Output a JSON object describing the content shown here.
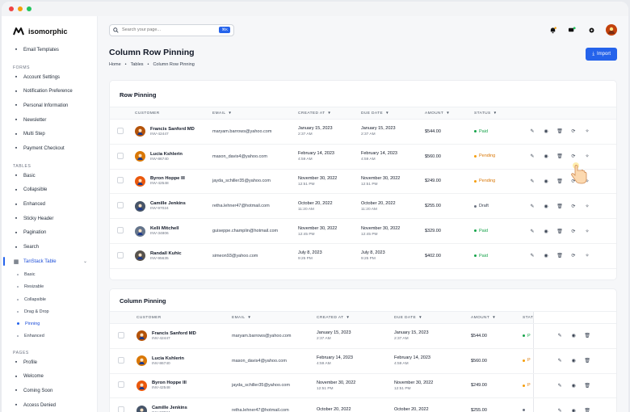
{
  "colors": {
    "accent": "#2563eb",
    "paid": "#16a34a",
    "pending": "#f59e0b",
    "draft": "#6b7280"
  },
  "brand": {
    "name": "isomorphic"
  },
  "sidebar": {
    "top_items": [
      {
        "label": "Email Templates",
        "icon": "mail-icon"
      }
    ],
    "forms_title": "FORMS",
    "forms_items": [
      {
        "label": "Account Settings",
        "icon": "user-settings-icon"
      },
      {
        "label": "Notification Preference",
        "icon": "bell-icon"
      },
      {
        "label": "Personal Information",
        "icon": "id-card-icon"
      },
      {
        "label": "Newsletter",
        "icon": "newsletter-icon"
      },
      {
        "label": "Multi Step",
        "icon": "steps-icon"
      },
      {
        "label": "Payment Checkout",
        "icon": "card-icon"
      }
    ],
    "tables_title": "TABLES",
    "tables_items": [
      {
        "label": "Basic",
        "icon": "grid-icon"
      },
      {
        "label": "Collapsible",
        "icon": "collapse-icon"
      },
      {
        "label": "Enhanced",
        "icon": "table-icon"
      },
      {
        "label": "Sticky Header",
        "icon": "sticky-icon"
      },
      {
        "label": "Pagination",
        "icon": "pagination-icon"
      },
      {
        "label": "Search",
        "icon": "search-table-icon"
      }
    ],
    "tanstack": {
      "label": "TanStack Table",
      "icon": "tanstack-icon"
    },
    "tanstack_subitems": [
      {
        "label": "Basic"
      },
      {
        "label": "Resizable"
      },
      {
        "label": "Collapsible"
      },
      {
        "label": "Drag & Drop"
      },
      {
        "label": "Pinning"
      },
      {
        "label": "Enhanced"
      }
    ],
    "pages_title": "PAGES",
    "pages_items": [
      {
        "label": "Profile",
        "icon": "profile-icon"
      },
      {
        "label": "Welcome",
        "icon": "welcome-icon"
      },
      {
        "label": "Coming Soon",
        "icon": "rocket-icon"
      },
      {
        "label": "Access Denied",
        "icon": "lock-icon"
      }
    ]
  },
  "search": {
    "placeholder": "Search your page...",
    "shortcut": "⌘K"
  },
  "page": {
    "title": "Column Row Pinning",
    "breadcrumb": [
      "Home",
      "Tables",
      "Column Row Pinning"
    ],
    "import_label": "Import"
  },
  "row_pinning": {
    "title": "Row Pinning",
    "headers": {
      "customer": "CUSTOMER",
      "email": "EMAIL",
      "created": "CREATED AT",
      "due": "DUE DATE",
      "amount": "AMOUNT",
      "status": "STATUS"
    },
    "rows": [
      {
        "name": "Francis Sanford MD",
        "inv": "INV-42447",
        "email": "maryam.barrows@yahoo.com",
        "created_date": "January 15, 2023",
        "created_time": "2:37 AM",
        "due_date": "January 15, 2023",
        "due_time": "2:37 AM",
        "amount": "$544.00",
        "status": "Paid",
        "status_key": "paid",
        "avatar": "#b45309"
      },
      {
        "name": "Lucia Kshlerin",
        "inv": "INV-86740",
        "email": "mason_davis4@yahoo.com",
        "created_date": "February 14, 2023",
        "created_time": "4:59 AM",
        "due_date": "February 14, 2023",
        "due_time": "4:59 AM",
        "amount": "$560.00",
        "status": "Pending",
        "status_key": "pending",
        "avatar": "#d97706"
      },
      {
        "name": "Byron Hoppe III",
        "inv": "INV-42548",
        "email": "jayda_schiller35@yahoo.com",
        "created_date": "November 30, 2022",
        "created_time": "12:51 PM",
        "due_date": "November 30, 2022",
        "due_time": "12:51 PM",
        "amount": "$249.00",
        "status": "Pending",
        "status_key": "pending",
        "avatar": "#ea580c"
      },
      {
        "name": "Camille Jenkins",
        "inv": "INV-97024",
        "email": "retha.lehner47@hotmail.com",
        "created_date": "October 20, 2022",
        "created_time": "11:20 AM",
        "due_date": "October 20, 2022",
        "due_time": "11:20 AM",
        "amount": "$255.00",
        "status": "Draft",
        "status_key": "draft",
        "avatar": "#475569"
      },
      {
        "name": "Kelli Mitchell",
        "inv": "INV-34806",
        "email": "guiseppe.champlin@hotmail.com",
        "created_date": "November 30, 2022",
        "created_time": "12:45 PM",
        "due_date": "November 30, 2022",
        "due_time": "12:45 PM",
        "amount": "$329.00",
        "status": "Paid",
        "status_key": "paid",
        "avatar": "#64748b"
      },
      {
        "name": "Randall Kuhic",
        "inv": "INV-95635",
        "email": "simeon93@yahoo.com",
        "created_date": "July 8, 2023",
        "created_time": "9:25 PM",
        "due_date": "July 8, 2023",
        "due_time": "9:25 PM",
        "amount": "$402.00",
        "status": "Paid",
        "status_key": "paid",
        "avatar": "#57534e"
      }
    ]
  },
  "column_pinning": {
    "title": "Column Pinning",
    "headers": {
      "customer": "CUSTOMER",
      "email": "EMAIL",
      "created": "CREATED AT",
      "due": "DUE DATE",
      "amount": "AMOUNT",
      "status": "STAT"
    },
    "rows": [
      {
        "name": "Francis Sanford MD",
        "inv": "INV-42447",
        "email": "maryam.barrows@yahoo.com",
        "created_date": "January 15, 2023",
        "created_time": "2:37 AM",
        "due_date": "January 15, 2023",
        "due_time": "2:37 AM",
        "amount": "$544.00",
        "status": "P",
        "status_key": "paid",
        "avatar": "#b45309"
      },
      {
        "name": "Lucia Kshlerin",
        "inv": "INV-86740",
        "email": "mason_davis4@yahoo.com",
        "created_date": "February 14, 2023",
        "created_time": "4:59 AM",
        "due_date": "February 14, 2023",
        "due_time": "4:59 AM",
        "amount": "$560.00",
        "status": "P",
        "status_key": "pending",
        "avatar": "#d97706"
      },
      {
        "name": "Byron Hoppe III",
        "inv": "INV-42548",
        "email": "jayda_schiller35@yahoo.com",
        "created_date": "November 30, 2022",
        "created_time": "12:51 PM",
        "due_date": "November 30, 2022",
        "due_time": "12:51 PM",
        "amount": "$249.00",
        "status": "P",
        "status_key": "pending",
        "avatar": "#ea580c"
      },
      {
        "name": "Camille Jenkins",
        "inv": "INV-97024",
        "email": "retha.lehner47@hotmail.com",
        "created_date": "October 20, 2022",
        "created_time": "",
        "due_date": "October 20, 2022",
        "due_time": "",
        "amount": "$255.00",
        "status": "",
        "status_key": "draft",
        "avatar": "#475569"
      }
    ]
  }
}
